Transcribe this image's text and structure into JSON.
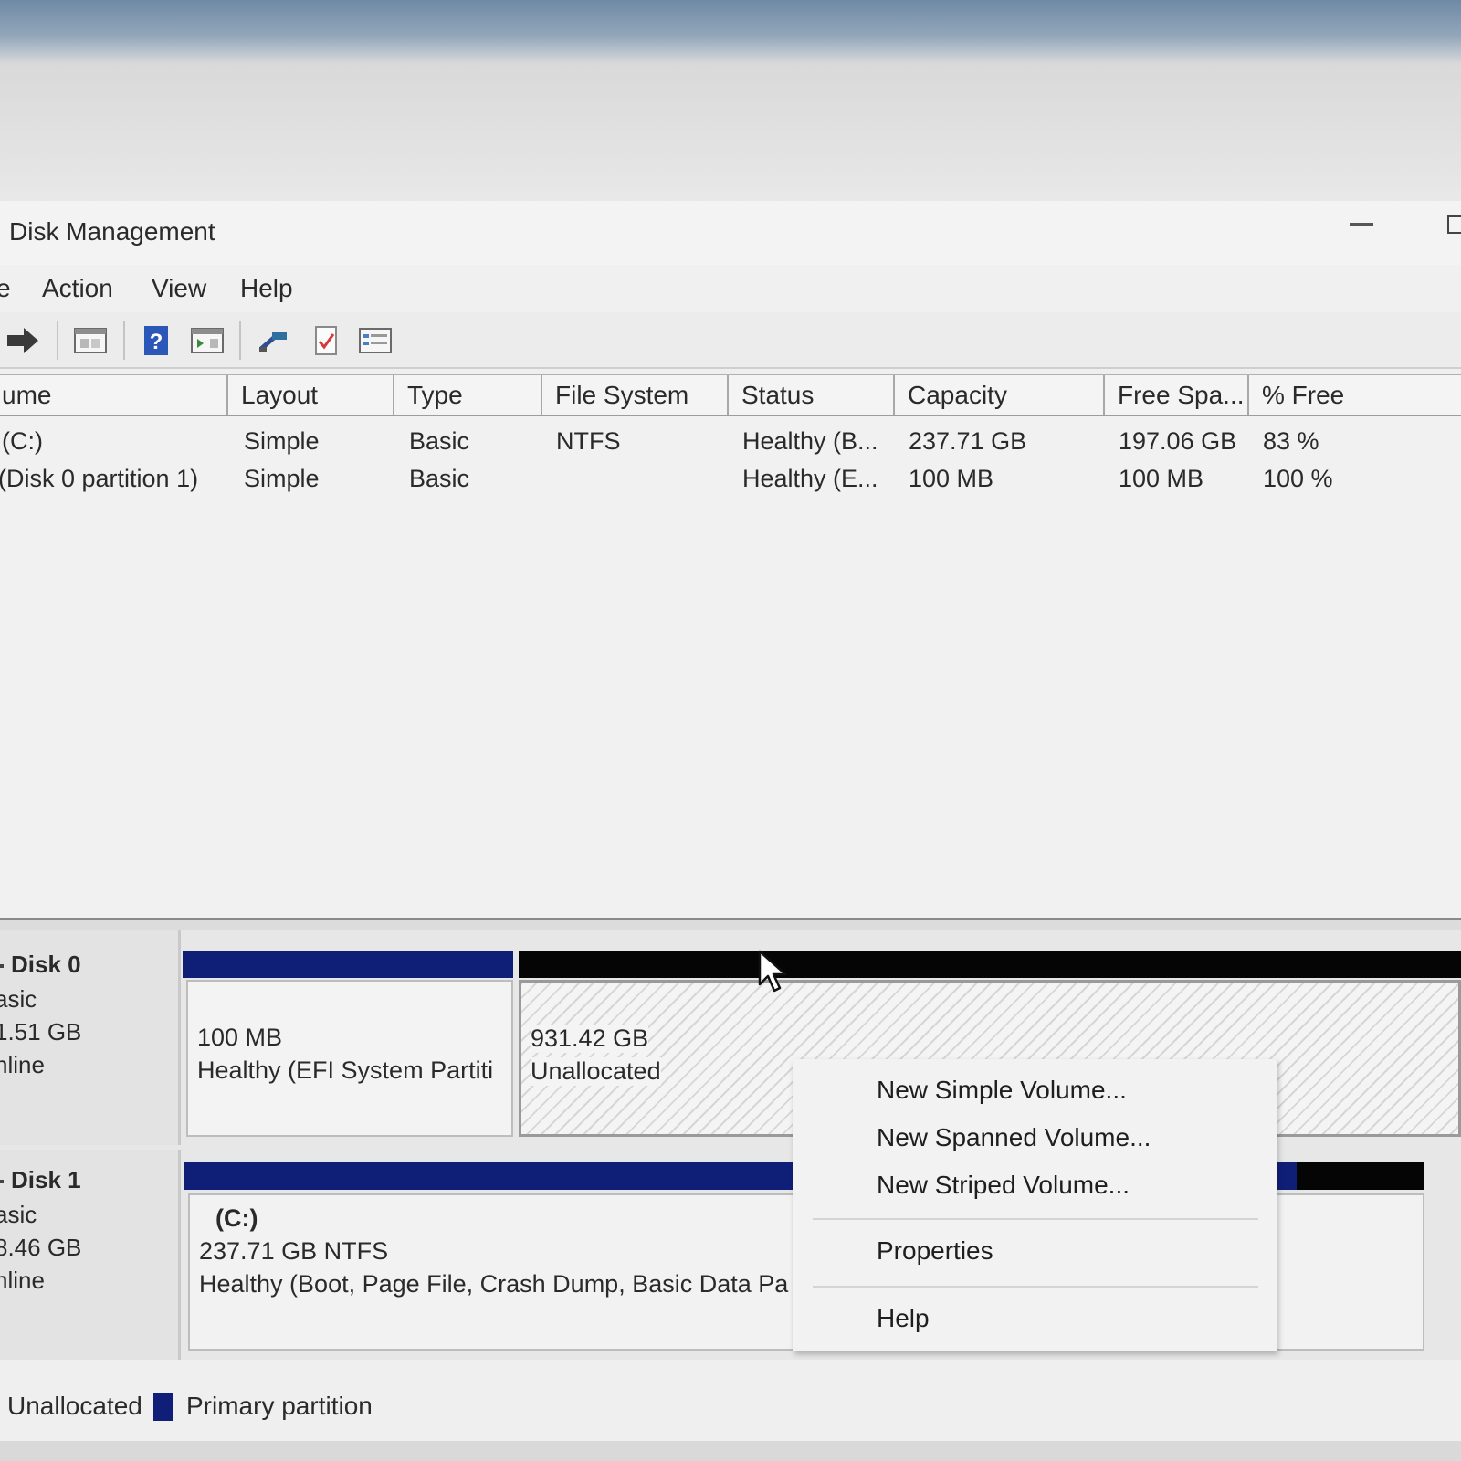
{
  "window": {
    "title": "Disk Management"
  },
  "menu": {
    "file_partial": "e",
    "action": "Action",
    "view": "View",
    "help": "Help"
  },
  "toolbar": {
    "icons": [
      "forward-icon",
      "console-tree-icon",
      "help-icon",
      "action-pane-icon",
      "connect-icon",
      "properties-icon",
      "list-view-icon"
    ]
  },
  "volume_list": {
    "columns": [
      "ume",
      "Layout",
      "Type",
      "File System",
      "Status",
      "Capacity",
      "Free Spa...",
      "% Free"
    ],
    "rows": [
      [
        "(C:)",
        "Simple",
        "Basic",
        "NTFS",
        "Healthy (B...",
        "237.71 GB",
        "197.06 GB",
        "83 %"
      ],
      [
        "(Disk 0 partition 1)",
        "Simple",
        "Basic",
        "",
        "Healthy (E...",
        "100 MB",
        "100 MB",
        "100 %"
      ]
    ]
  },
  "disks": [
    {
      "name": "Disk 0",
      "type": "asic",
      "size": "1.51 GB",
      "state": "nline",
      "partitions": [
        {
          "size": "100 MB",
          "status": "Healthy (EFI System Partiti"
        },
        {
          "size": "931.42 GB",
          "status": "Unallocated"
        }
      ]
    },
    {
      "name": "Disk 1",
      "type": "asic",
      "size": "8.46 GB",
      "state": "nline",
      "partitions": [
        {
          "label": "(C:)",
          "size": "237.71 GB NTFS",
          "status": "Healthy (Boot, Page File, Crash Dump, Basic Data Pa"
        }
      ]
    }
  ],
  "context_menu": {
    "items": [
      "New Simple Volume...",
      "New Spanned Volume...",
      "New Striped Volume...",
      "Properties",
      "Help"
    ]
  },
  "legend": {
    "unallocated": "Unallocated",
    "primary": "Primary partition"
  },
  "colors": {
    "primary_partition": "#0f1f78",
    "unallocated_bar": "#050505"
  }
}
